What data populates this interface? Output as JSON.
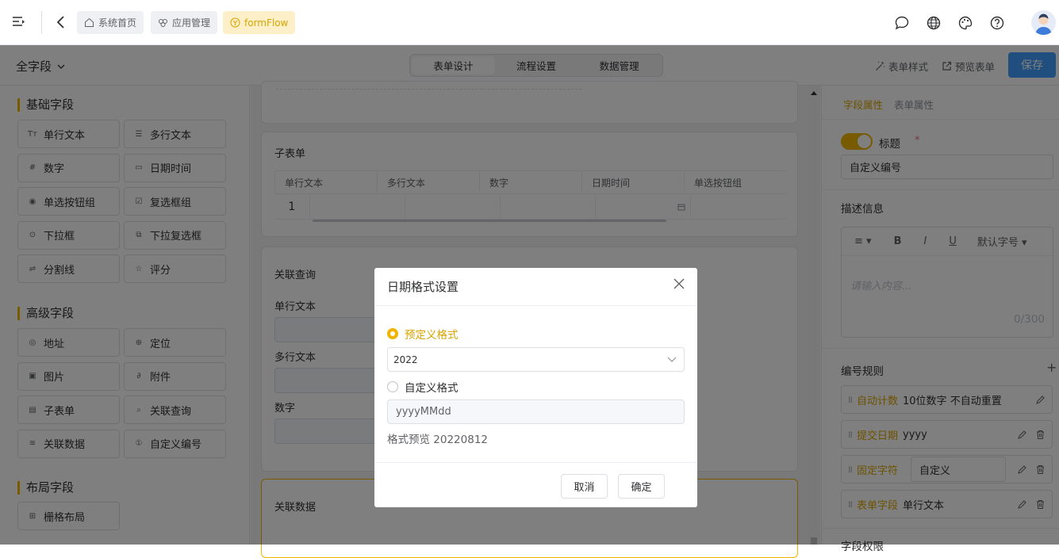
{
  "topbar": {
    "breadcrumbs": [
      {
        "label": "系统首页",
        "icon": "home-icon"
      },
      {
        "label": "应用管理",
        "icon": "apps-icon"
      },
      {
        "label": "formFlow",
        "icon": "flow-icon",
        "active": true
      }
    ],
    "icons": [
      "chat-icon",
      "globe-icon",
      "palette-icon",
      "help-icon"
    ]
  },
  "subbar": {
    "scope": "全字段",
    "tabs": [
      {
        "label": "表单设计",
        "active": true
      },
      {
        "label": "流程设置"
      },
      {
        "label": "数据管理"
      }
    ],
    "form_style": "表单样式",
    "preview": "预览表单",
    "save": "保存"
  },
  "left": {
    "basic_title": "基础字段",
    "basic": [
      {
        "label": "单行文本",
        "icon": "text-icon",
        "glyph": "Tт"
      },
      {
        "label": "多行文本",
        "icon": "multiline-icon",
        "glyph": "☰"
      },
      {
        "label": "数字",
        "icon": "hash-icon",
        "glyph": "#"
      },
      {
        "label": "日期时间",
        "icon": "calendar-icon",
        "glyph": "▭"
      },
      {
        "label": "单选按钮组",
        "icon": "radio-icon",
        "glyph": "◉"
      },
      {
        "label": "复选框组",
        "icon": "checkbox-icon",
        "glyph": "☑"
      },
      {
        "label": "下拉框",
        "icon": "dropdown-icon",
        "glyph": "⊙"
      },
      {
        "label": "下拉复选框",
        "icon": "multi-dropdown-icon",
        "glyph": "⧉"
      },
      {
        "label": "分割线",
        "icon": "divider-icon",
        "glyph": "⇌"
      },
      {
        "label": "评分",
        "icon": "star-icon",
        "glyph": "☆"
      }
    ],
    "advanced_title": "高级字段",
    "advanced": [
      {
        "label": "地址",
        "icon": "address-icon",
        "glyph": "◎"
      },
      {
        "label": "定位",
        "icon": "location-icon",
        "glyph": "⊕"
      },
      {
        "label": "图片",
        "icon": "image-icon",
        "glyph": "▣"
      },
      {
        "label": "附件",
        "icon": "attachment-icon",
        "glyph": "∂"
      },
      {
        "label": "子表单",
        "icon": "subform-icon",
        "glyph": "▤"
      },
      {
        "label": "关联查询",
        "icon": "search-icon",
        "glyph": "⌕"
      },
      {
        "label": "关联数据",
        "icon": "database-icon",
        "glyph": "≋"
      },
      {
        "label": "自定义编号",
        "icon": "number-icon",
        "glyph": "①"
      }
    ],
    "layout_title": "布局字段",
    "layout": [
      {
        "label": "栅格布局",
        "icon": "grid-icon",
        "glyph": "⊞"
      }
    ]
  },
  "canvas": {
    "subform": {
      "title": "子表单",
      "columns": [
        "单行文本",
        "多行文本",
        "数字",
        "日期时间",
        "单选按钮组"
      ],
      "row_index": "1"
    },
    "query": {
      "title": "关联查询",
      "fields": [
        "单行文本",
        "多行文本",
        "数字"
      ]
    },
    "linked_data": {
      "title": "关联数据"
    }
  },
  "right": {
    "tabs": [
      {
        "label": "字段属性",
        "active": true
      },
      {
        "label": "表单属性"
      }
    ],
    "title_label": "标题",
    "required_mark": "*",
    "title_value": "自定义编号",
    "desc_label": "描述信息",
    "editor": {
      "font": "默认字号",
      "placeholder": "请输入内容...",
      "count": "0/300"
    },
    "rules_label": "编号规则",
    "rules": [
      {
        "key": "自动计数",
        "value": "10位数字 不自动重置"
      },
      {
        "key": "提交日期",
        "value": "yyyy"
      },
      {
        "key": "固定字符",
        "value": "自定义"
      },
      {
        "key": "表单字段",
        "value": "单行文本"
      }
    ],
    "bottom_label": "字段权限"
  },
  "dialog": {
    "title": "日期格式设置",
    "predefined_label": "预定义格式",
    "predefined_value": "2022",
    "custom_label": "自定义格式",
    "custom_value": "yyyyMMdd",
    "preview": "格式预览 20220812",
    "cancel": "取消",
    "confirm": "确定"
  },
  "colors": {
    "accent": "#f0b400",
    "primary": "#409eff"
  }
}
